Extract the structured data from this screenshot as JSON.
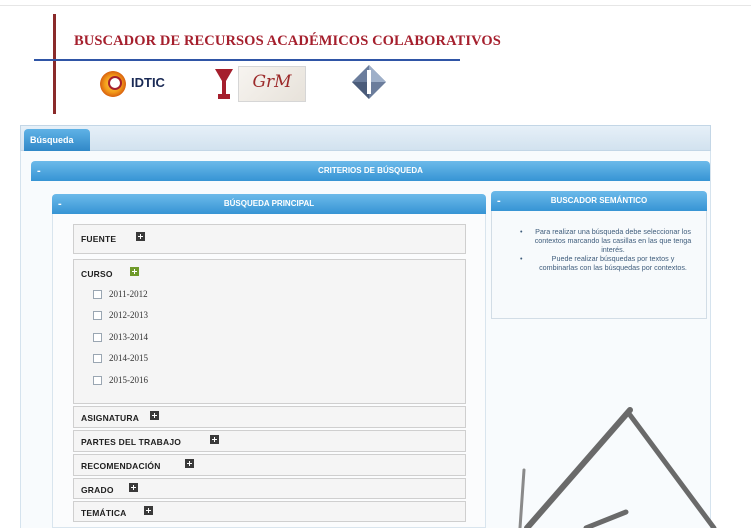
{
  "header": {
    "title": "BUSCADOR DE RECURSOS ACADÉMICOS COLABORATIVOS",
    "logo_gidtic_text": "IDTIC",
    "logo_script_text": "GrM"
  },
  "tabs": [
    {
      "label": "Búsqueda",
      "active": true
    }
  ],
  "criteria_bar": {
    "title": "CRITERIOS DE BÚSQUEDA",
    "toggle": "-"
  },
  "main_search": {
    "title": "BÚSQUEDA PRINCIPAL",
    "toggle": "-",
    "filters": [
      {
        "label": "FUENTE",
        "expanded": false
      },
      {
        "label": "CURSO",
        "expanded": true,
        "options": [
          "2011-2012",
          "2012-2013",
          "2013-2014",
          "2014-2015",
          "2015-2016"
        ]
      },
      {
        "label": "ASIGNATURA",
        "expanded": false
      },
      {
        "label": "PARTES DEL TRABAJO",
        "expanded": false
      },
      {
        "label": "RECOMENDACIÓN",
        "expanded": false
      },
      {
        "label": "GRADO",
        "expanded": false
      },
      {
        "label": "TEMÁTICA",
        "expanded": false
      }
    ]
  },
  "semantic_search": {
    "title": "BUSCADOR SEMÁNTICO",
    "toggle": "-",
    "tips": [
      "Para realizar una búsqueda debe seleccionar los contextos marcando las casillas en las que tenga interés.",
      "Puede realizar búsquedas por textos y combinarlas con las búsquedas por contextos."
    ]
  },
  "colors": {
    "title_red": "#a51f2d",
    "header_blue": "#2f55a6",
    "bar_blue": "#3694d4",
    "expand_green": "#6f9a2a"
  }
}
